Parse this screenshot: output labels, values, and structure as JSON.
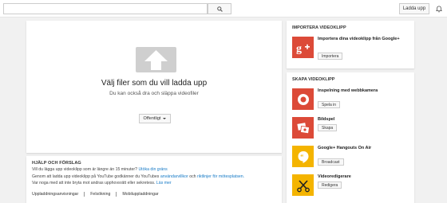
{
  "header": {
    "search": {
      "value": "",
      "placeholder": ""
    },
    "upload_label": "Ladda upp"
  },
  "upload": {
    "title": "Välj filer som du vill ladda upp",
    "subtitle": "Du kan också dra och släppa videofiler",
    "privacy": "Offentligt"
  },
  "help": {
    "title": "HJÄLP OCH FÖRSLAG",
    "line1_text": "Vill du lägga upp videoklipp som är längre än 15 minuter?",
    "line1_link": "Utöka din gräns",
    "line2_a": "Genom att ladda upp videoklipp på YouTube godkänner du YouTubes",
    "line2_link1": "användarvillkor",
    "line2_b": "och",
    "line2_link2": "riktlinjer för mötesplatsen.",
    "line3_text": "Var noga med att inte bryta mot andras upphovsrätt eller sekretess.",
    "line3_link": "Läs mer",
    "links": [
      "Uppladdningsanvisningar",
      "Felsökning",
      "Mobiluppladdningar"
    ]
  },
  "import": {
    "title": "IMPORTERA VIDEOKLIPP",
    "item_label": "Importera dina videoklipp från Google+",
    "item_button": "Importera"
  },
  "create": {
    "title": "SKAPA VIDEOKLIPP",
    "items": [
      {
        "label": "Inspelning med webbkamera",
        "button": "Spela in"
      },
      {
        "label": "Bildspel",
        "button": "Skapa"
      },
      {
        "label": "Google+ Hangouts On Air",
        "button": "Broadcast"
      },
      {
        "label": "Videoredigerare",
        "button": "Redigera"
      }
    ]
  },
  "colors": {
    "gplus_red": "#dc4a38",
    "hangouts_yellow": "#f4b400",
    "link_blue": "#167ac6"
  }
}
